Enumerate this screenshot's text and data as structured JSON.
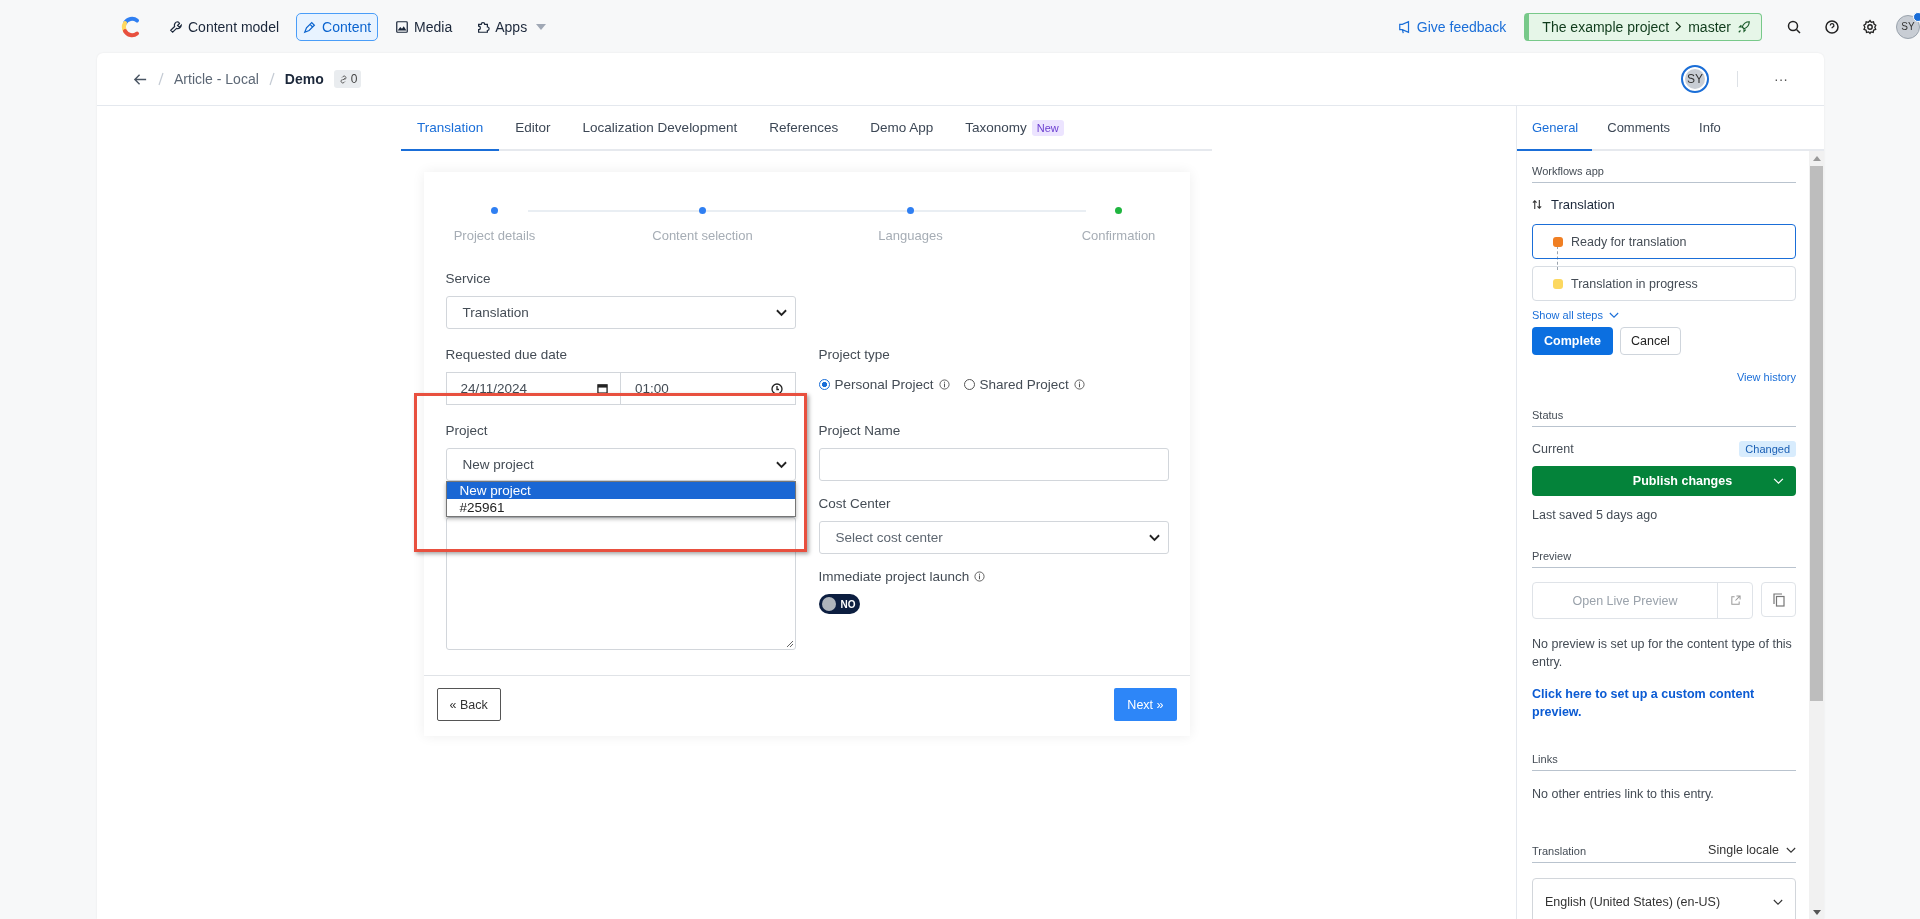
{
  "top_nav": {
    "items": [
      {
        "label": "Content model",
        "selected": false
      },
      {
        "label": "Content",
        "selected": true
      },
      {
        "label": "Media",
        "selected": false
      },
      {
        "label": "Apps",
        "selected": false,
        "dropdown": true
      }
    ],
    "feedback": "Give feedback",
    "environment": {
      "project": "The example project",
      "branch": "master"
    },
    "avatar": {
      "initials": "SY",
      "notification": true
    }
  },
  "entry_header": {
    "breadcrumb": [
      "Article - Local",
      "Demo"
    ],
    "links_count": "0",
    "avatar": "SY",
    "more": "···"
  },
  "tabs": [
    {
      "label": "Translation",
      "selected": true
    },
    {
      "label": "Editor",
      "selected": false
    },
    {
      "label": "Localization Development",
      "selected": false
    },
    {
      "label": "References",
      "selected": false
    },
    {
      "label": "Demo App",
      "selected": false
    },
    {
      "label": "Taxonomy",
      "selected": false,
      "badge": "New"
    }
  ],
  "wizard": {
    "steps": [
      {
        "label": "Project details",
        "color": "#2f7ff2"
      },
      {
        "label": "Content selection",
        "color": "#2f7ff2"
      },
      {
        "label": "Languages",
        "color": "#2f7ff2"
      },
      {
        "label": "Confirmation",
        "color": "#1fb53f"
      }
    ],
    "service": {
      "label": "Service",
      "value": "Translation"
    },
    "due_date": {
      "label": "Requested due date",
      "date": "24/11/2024",
      "time": "01:00"
    },
    "project_type": {
      "label": "Project type",
      "options": [
        {
          "label": "Personal Project",
          "selected": true
        },
        {
          "label": "Shared Project",
          "selected": false
        }
      ]
    },
    "project": {
      "label": "Project",
      "value": "New project",
      "options": [
        {
          "label": "New project",
          "selected": true
        },
        {
          "label": "#25961",
          "selected": false
        }
      ]
    },
    "project_name": {
      "label": "Project Name"
    },
    "cost_center": {
      "label": "Cost Center",
      "placeholder": "Select cost center"
    },
    "launch": {
      "label": "Immediate project launch",
      "on": false,
      "state_text": "NO"
    },
    "back": "« Back",
    "next": "Next »"
  },
  "sidebar": {
    "tabs": [
      {
        "label": "General",
        "selected": true
      },
      {
        "label": "Comments",
        "selected": false
      },
      {
        "label": "Info",
        "selected": false
      }
    ],
    "workflows": {
      "heading": "Workflows app",
      "name": "Translation",
      "steps": [
        {
          "label": "Ready for translation",
          "color": "#f07f23",
          "selected": true
        },
        {
          "label": "Translation in progress",
          "color": "#fcd860",
          "selected": false
        }
      ],
      "show_all": "Show all steps",
      "complete": "Complete",
      "cancel": "Cancel",
      "history": "View history"
    },
    "status": {
      "heading": "Status",
      "current": "Current",
      "badge": "Changed",
      "publish": "Publish changes",
      "saved": "Last saved 5 days ago"
    },
    "preview": {
      "heading": "Preview",
      "open": "Open Live Preview",
      "note": "No preview is set up for the content type of this entry.",
      "link": "Click here to set up a custom content preview."
    },
    "links": {
      "heading": "Links",
      "note": "No other entries link to this entry."
    },
    "translation": {
      "heading": "Translation",
      "mode": "Single locale",
      "locale": "English (United States) (en-US)"
    }
  }
}
